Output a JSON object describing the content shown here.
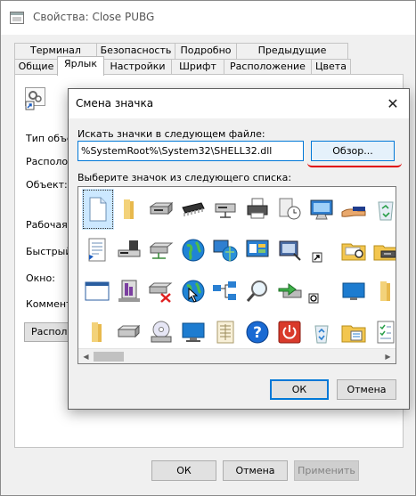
{
  "properties_window": {
    "title": "Свойства: Close PUBG",
    "tabs_row1": [
      "Терминал",
      "Безопасность",
      "Подробно",
      "Предыдущие версии"
    ],
    "tabs_row2": [
      "Общие",
      "Ярлык",
      "Настройки",
      "Шрифт",
      "Расположение",
      "Цвета"
    ],
    "active_tab": "Ярлык",
    "fields": {
      "type": "Тип объе",
      "location": "Располож",
      "object": "Объект:",
      "workdir": "Рабочая п",
      "hotkey": "Быстрый",
      "window": "Окно:",
      "comment": "Коммент"
    },
    "location_button": "Располо",
    "buttons": {
      "ok": "ОК",
      "cancel": "Отмена",
      "apply": "Применить"
    }
  },
  "change_icon_dialog": {
    "title": "Смена значка",
    "close_glyph": "✕",
    "file_label": "Искать значки в следующем файле:",
    "file_path": "%SystemRoot%\\System32\\SHELL32.dll",
    "browse_button": "Обзор...",
    "list_label": "Выберите значок из следующего списка:",
    "icons": [
      "blank-document-icon",
      "folder-icon",
      "floppy-drive-icon",
      "memory-chip-icon",
      "network-drive-icon",
      "printer-icon",
      "network-clock-icon",
      "display-icon",
      "hand-share-icon",
      "recycle-bin-icon",
      "text-document-icon",
      "server-icon",
      "network-hdd-icon",
      "globe-icon",
      "network-globe-icon",
      "control-panel-icon",
      "shortcut-overlay-icon",
      "shortcut-arrow-icon",
      "folder-search-icon",
      "disk-drive-icon",
      "window-icon",
      "defragmenter-icon",
      "disconnected-drive-icon",
      "globe-cursor-icon",
      "network-icon",
      "search-magnifier-icon",
      "export-arrow-icon",
      "power-small-icon",
      "blank-screen-icon",
      "folder-open-icon",
      "folder-small-icon",
      "hard-drive-icon",
      "cd-drive-icon",
      "computer-icon",
      "file-grid-icon",
      "help-icon",
      "shutdown-icon",
      "recycle-bin-small-icon",
      "sticky-folder-icon",
      "checklist-icon"
    ],
    "buttons": {
      "ok": "ОК",
      "cancel": "Отмена"
    }
  }
}
